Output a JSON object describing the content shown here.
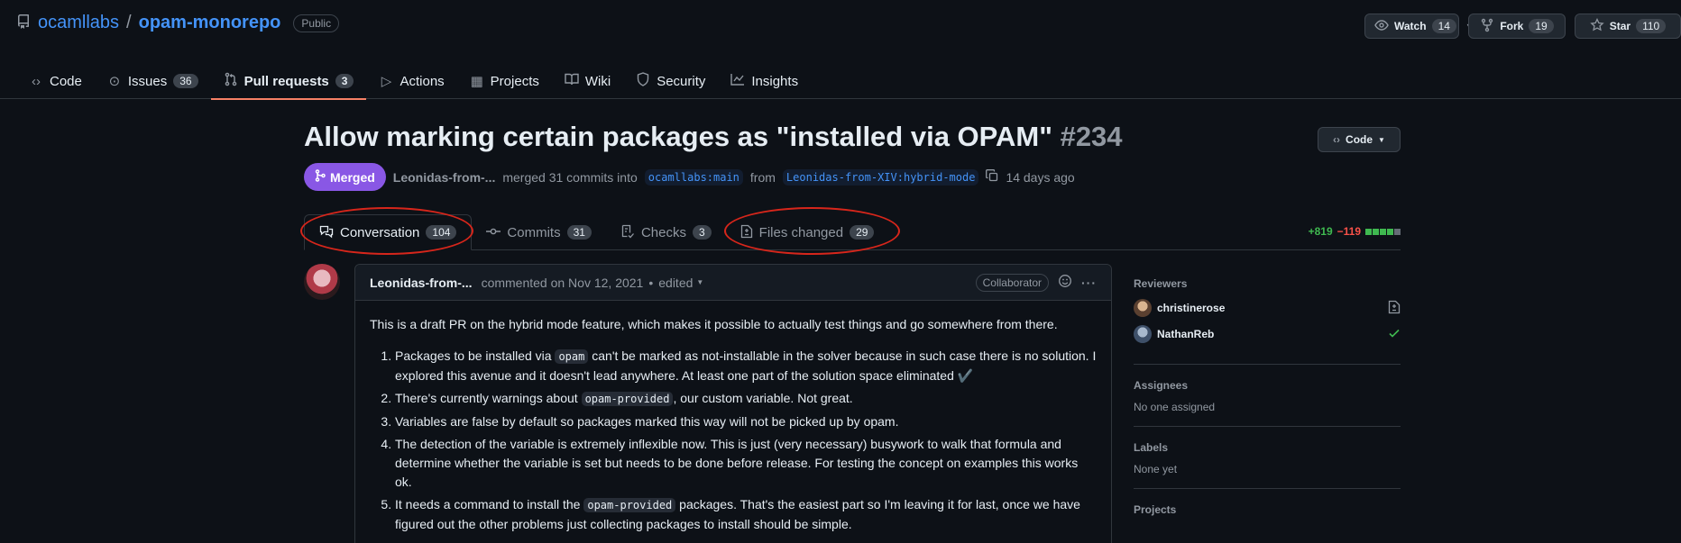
{
  "repo": {
    "owner": "ocamllabs",
    "separator": "/",
    "name": "opam-monorepo",
    "visibility": "Public"
  },
  "actions": {
    "watch": {
      "label": "Watch",
      "count": "14"
    },
    "fork": {
      "label": "Fork",
      "count": "19"
    },
    "star": {
      "label": "Star",
      "count": "110"
    }
  },
  "nav": {
    "code": "Code",
    "issues": {
      "label": "Issues",
      "count": "36"
    },
    "pulls": {
      "label": "Pull requests",
      "count": "3"
    },
    "actions": "Actions",
    "projects": "Projects",
    "wiki": "Wiki",
    "security": "Security",
    "insights": "Insights"
  },
  "pr": {
    "title": "Allow marking certain packages as \"installed via OPAM\"",
    "number": "#234",
    "code_button": "Code",
    "state": "Merged",
    "author": "Leonidas-from-...",
    "merged_text": "merged 31 commits into",
    "base_branch": "ocamllabs:main",
    "from_text": "from",
    "head_branch": "Leonidas-from-XIV:hybrid-mode",
    "time": "14 days ago"
  },
  "pr_tabs": {
    "conversation": {
      "label": "Conversation",
      "count": "104"
    },
    "commits": {
      "label": "Commits",
      "count": "31"
    },
    "checks": {
      "label": "Checks",
      "count": "3"
    },
    "files": {
      "label": "Files changed",
      "count": "29"
    }
  },
  "diffstat": {
    "additions": "+819",
    "deletions": "−119"
  },
  "comment": {
    "author": "Leonidas-from-...",
    "action": "commented on Nov 12, 2021",
    "bullet": "•",
    "edited": "edited",
    "role": "Collaborator",
    "intro": "This is a draft PR on the hybrid mode feature, which makes it possible to actually test things and go somewhere from there.",
    "items": [
      {
        "pre": "Packages to be installed via ",
        "code": "opam",
        "post": " can't be marked as not-installable in the solver because in such case there is no solution. I explored this avenue and it doesn't lead anywhere. At least one part of the solution space eliminated ✔️"
      },
      {
        "pre": "There's currently warnings about ",
        "code": "opam-provided",
        "post": ", our custom variable. Not great."
      },
      {
        "pre": "Variables are false by default so packages marked this way will not be picked up by opam.",
        "code": "",
        "post": ""
      },
      {
        "pre": "The detection of the variable is extremely inflexible now. This is just (very necessary) busywork to walk that formula and determine whether the variable is set but needs to be done before release. For testing the concept on examples this works ok.",
        "code": "",
        "post": ""
      },
      {
        "pre": "It needs a command to install the ",
        "code": "opam-provided",
        "post": " packages. That's the easiest part so I'm leaving it for last, once we have figured out the other problems just collecting packages to install should be simple."
      }
    ]
  },
  "sidebar": {
    "reviewers": {
      "heading": "Reviewers",
      "people": [
        {
          "name": "christinerose",
          "status_icon": "file-diff-icon"
        },
        {
          "name": "NathanReb",
          "status_icon": "check-icon"
        }
      ]
    },
    "assignees": {
      "heading": "Assignees",
      "value": "No one assigned"
    },
    "labels": {
      "heading": "Labels",
      "value": "None yet"
    },
    "projects": {
      "heading": "Projects"
    }
  },
  "colors": {
    "accent": "#4493f8",
    "merged": "#8957e5",
    "annotation": "#d7261b",
    "add": "#3fb950",
    "delete": "#f85149"
  }
}
